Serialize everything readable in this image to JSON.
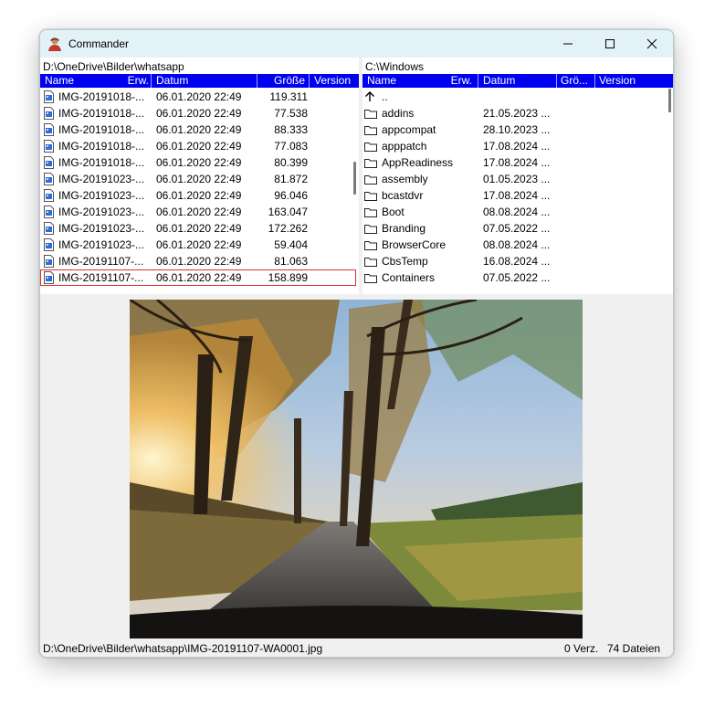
{
  "window": {
    "title": "Commander"
  },
  "icons": {
    "app": "user-avatar-icon",
    "minimize": "minimize-icon",
    "maximize": "maximize-icon",
    "close": "close-icon",
    "file": "image-file-icon",
    "folder": "folder-icon",
    "up": "arrow-up-icon"
  },
  "colors": {
    "header_bg": "#0000f0",
    "selection_border": "#e03030",
    "titlebar_bg": "#e3f2f6"
  },
  "left_pane": {
    "path": "D:\\OneDrive\\Bilder\\whatsapp",
    "columns": [
      "Name",
      "Erw.",
      "Datum",
      "Größe",
      "Version"
    ],
    "rows": [
      {
        "name": "IMG-20191018-...",
        "date": "06.01.2020 22:49",
        "size": "119.311"
      },
      {
        "name": "IMG-20191018-...",
        "date": "06.01.2020 22:49",
        "size": "77.538"
      },
      {
        "name": "IMG-20191018-...",
        "date": "06.01.2020 22:49",
        "size": "88.333"
      },
      {
        "name": "IMG-20191018-...",
        "date": "06.01.2020 22:49",
        "size": "77.083"
      },
      {
        "name": "IMG-20191018-...",
        "date": "06.01.2020 22:49",
        "size": "80.399"
      },
      {
        "name": "IMG-20191023-...",
        "date": "06.01.2020 22:49",
        "size": "81.872"
      },
      {
        "name": "IMG-20191023-...",
        "date": "06.01.2020 22:49",
        "size": "96.046"
      },
      {
        "name": "IMG-20191023-...",
        "date": "06.01.2020 22:49",
        "size": "163.047"
      },
      {
        "name": "IMG-20191023-...",
        "date": "06.01.2020 22:49",
        "size": "172.262"
      },
      {
        "name": "IMG-20191023-...",
        "date": "06.01.2020 22:49",
        "size": "59.404"
      },
      {
        "name": "IMG-20191107-...",
        "date": "06.01.2020 22:49",
        "size": "81.063"
      },
      {
        "name": "IMG-20191107-...",
        "date": "06.01.2020 22:49",
        "size": "158.899",
        "selected": true
      }
    ]
  },
  "right_pane": {
    "path": "C:\\Windows",
    "columns": [
      "Name",
      "Erw.",
      "Datum",
      "Grö...",
      "Version"
    ],
    "parent_label": "..",
    "rows": [
      {
        "name": "addins",
        "date": "21.05.2023 ..."
      },
      {
        "name": "appcompat",
        "date": "28.10.2023 ..."
      },
      {
        "name": "apppatch",
        "date": "17.08.2024 ..."
      },
      {
        "name": "AppReadiness",
        "date": "17.08.2024 ..."
      },
      {
        "name": "assembly",
        "date": "01.05.2023 ..."
      },
      {
        "name": "bcastdvr",
        "date": "17.08.2024 ..."
      },
      {
        "name": "Boot",
        "date": "08.08.2024 ..."
      },
      {
        "name": "Branding",
        "date": "07.05.2022 ..."
      },
      {
        "name": "BrowserCore",
        "date": "08.08.2024 ..."
      },
      {
        "name": "CbsTemp",
        "date": "16.08.2024 ..."
      },
      {
        "name": "Containers",
        "date": "07.05.2022 ..."
      }
    ]
  },
  "status": {
    "path": "D:\\OneDrive\\Bilder\\whatsapp\\IMG-20191107-WA0001.jpg",
    "dirs": "0 Verz.",
    "files": "74 Dateien"
  }
}
